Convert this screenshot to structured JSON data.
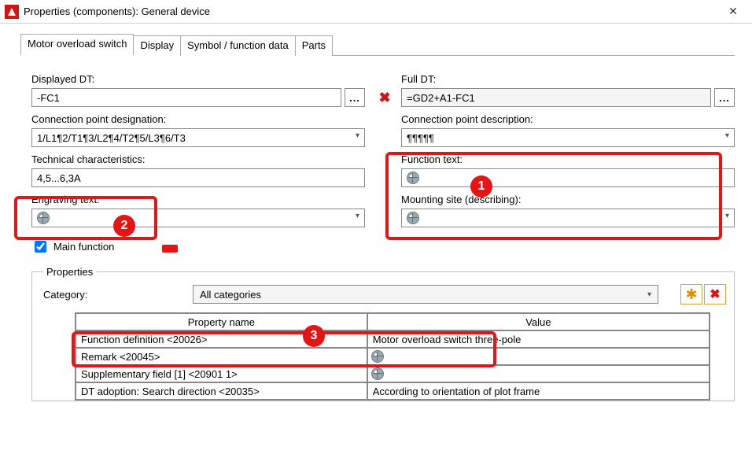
{
  "titlebar": {
    "title": "Properties (components): General device"
  },
  "tabs": [
    "Motor overload switch",
    "Display",
    "Symbol / function data",
    "Parts"
  ],
  "fields": {
    "displayed_dt_label": "Displayed DT:",
    "displayed_dt_value": "-FC1",
    "full_dt_label": "Full DT:",
    "full_dt_value": "=GD2+A1-FC1",
    "conn_pt_desig_label": "Connection point designation:",
    "conn_pt_desig_value": "1/L1¶2/T1¶3/L2¶4/T2¶5/L3¶6/T3",
    "conn_pt_desc_label": "Connection point description:",
    "conn_pt_desc_value": "¶¶¶¶¶",
    "tech_char_label": "Technical characteristics:",
    "tech_char_value": "4,5...6,3A",
    "func_text_label": "Function text:",
    "engraving_label": "Engraving text:",
    "mounting_label": "Mounting site (describing):",
    "main_function_label": "Main function"
  },
  "properties": {
    "legend": "Properties",
    "category_label": "Category:",
    "category_value": "All categories",
    "columns": {
      "name": "Property name",
      "value": "Value"
    },
    "rows": [
      {
        "name": "Function definition <20026>",
        "value": "Motor overload switch three-pole",
        "globe": false
      },
      {
        "name": "Remark <20045>",
        "value": "",
        "globe": true
      },
      {
        "name": "Supplementary field [1] <20901 1>",
        "value": "",
        "globe": true
      },
      {
        "name": "DT adoption: Search direction <20035>",
        "value": "According to orientation of plot frame",
        "globe": false
      }
    ]
  },
  "annotations": {
    "1": "1",
    "2": "2",
    "3": "3"
  }
}
